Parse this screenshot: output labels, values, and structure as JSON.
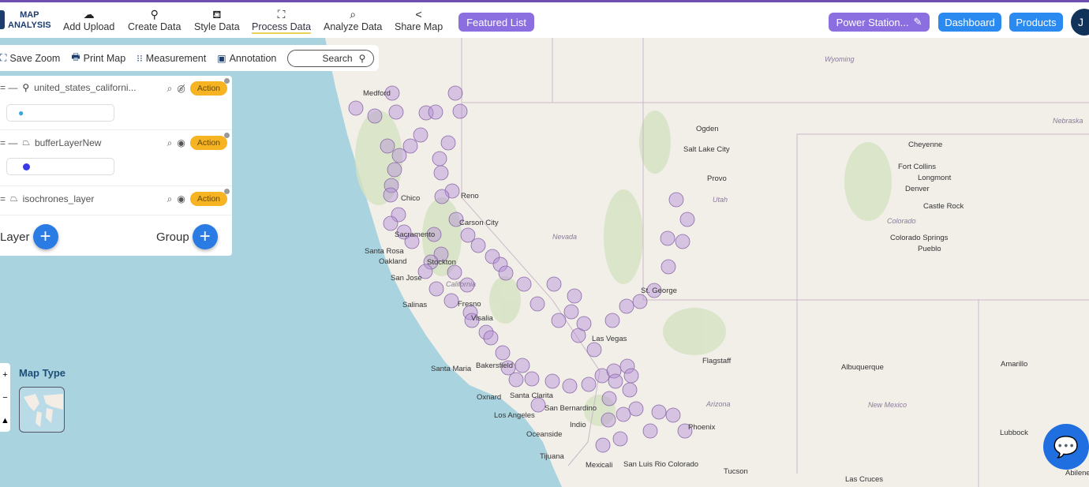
{
  "header": {
    "logo_line1": "MAP",
    "logo_line2": "ANALYSIS",
    "nav": [
      {
        "label": "Add Upload",
        "icon": "cloud-upload-icon"
      },
      {
        "label": "Create Data",
        "icon": "map-pin-icon"
      },
      {
        "label": "Style Data",
        "icon": "paint-bucket-icon"
      },
      {
        "label": "Process Data",
        "icon": "process-icon",
        "active": true
      },
      {
        "label": "Analyze Data",
        "icon": "analyze-icon"
      },
      {
        "label": "Share Map",
        "icon": "share-icon"
      }
    ],
    "featured": "Featured List",
    "project": "Power Station...",
    "dashboard": "Dashboard",
    "products": "Products",
    "avatar": "J"
  },
  "toolbar": {
    "save_zoom": "Save Zoom",
    "print_map": "Print Map",
    "measurement": "Measurement",
    "annotation": "Annotation",
    "search": "Search"
  },
  "layers": {
    "items": [
      {
        "name": "united_states_californi...",
        "visible": false,
        "action": "Action",
        "legend_color": "#3ba4dc"
      },
      {
        "name": "bufferLayerNew",
        "visible": true,
        "action": "Action",
        "legend_color": "#3a3ae8"
      },
      {
        "name": "isochrones_layer",
        "visible": true,
        "action": "Action"
      }
    ],
    "add_layer": "Layer",
    "add_group": "Group"
  },
  "map_type": "Map Type",
  "colors": {
    "accent": "#6f4fb0",
    "primary": "#2a7be4",
    "action": "#f6b322",
    "buffer": "#b48fd6"
  },
  "map_labels": {
    "cities": [
      "Medford",
      "Reno",
      "Chico",
      "Sacramento",
      "Santa Rosa",
      "Oakland",
      "San Jose",
      "Stockton",
      "Salinas",
      "Fresno",
      "Visalia",
      "Santa Maria",
      "Bakersfield",
      "Oxnard",
      "Santa Clarita",
      "Los Angeles",
      "San Bernardino",
      "Oceanside",
      "Indio",
      "Tijuana",
      "Mexicali",
      "San Luis Rio Colorado",
      "Las Vegas",
      "St. George",
      "Flagstaff",
      "Phoenix",
      "Tucson",
      "Ogden",
      "Salt Lake City",
      "Provo",
      "Cheyenne",
      "Fort Collins",
      "Longmont",
      "Denver",
      "Castle Rock",
      "Colorado Springs",
      "Pueblo",
      "Albuquerque",
      "Amarillo",
      "Lubbock",
      "Las Cruces",
      "Carson City",
      "Abilene"
    ],
    "states": [
      "Wyoming",
      "Nebraska",
      "Utah",
      "Nevada",
      "Colorado",
      "California",
      "Arizona",
      "New Mexico"
    ]
  }
}
